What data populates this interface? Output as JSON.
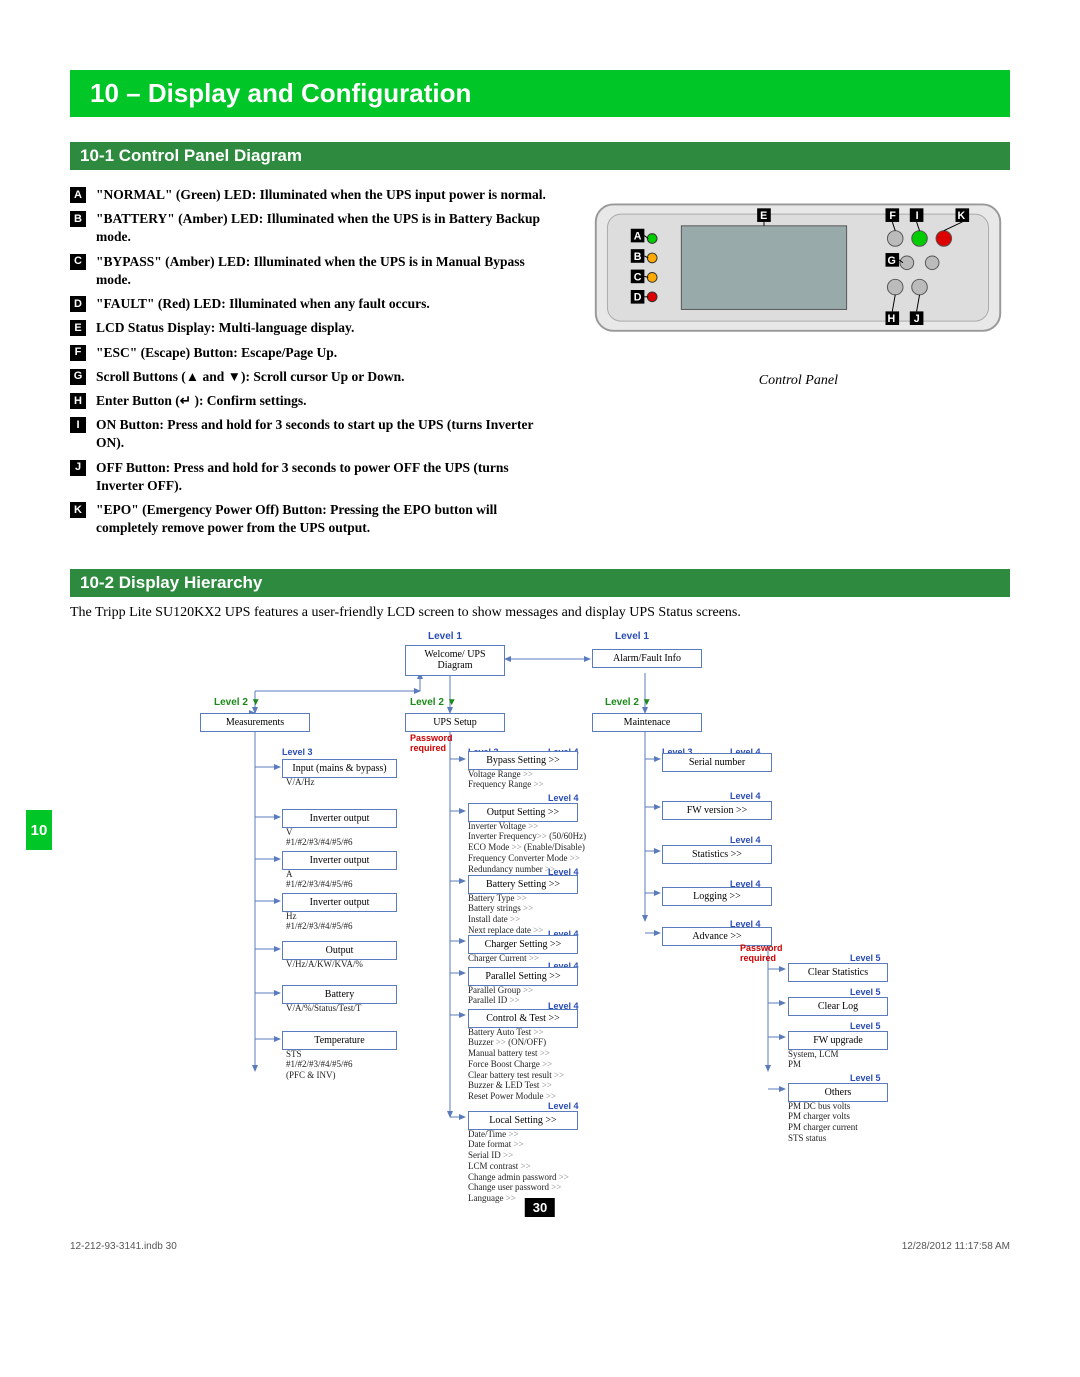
{
  "chapter": "10 – Display and Configuration",
  "section1": "10-1 Control Panel Diagram",
  "legend": {
    "A": "\"NORMAL\"  (Green) LED: Illuminated when the UPS input power is normal.",
    "B": "\"BATTERY\" (Amber) LED: Illuminated when the UPS is in Battery Backup mode.",
    "C": "\"BYPASS\" (Amber) LED: Illuminated when the UPS is in Manual Bypass mode.",
    "D": "\"FAULT\" (Red) LED: Illuminated when any fault occurs.",
    "E": "LCD Status Display: Multi-language display.",
    "F": "\"ESC\" (Escape) Button: Escape/Page Up.",
    "G": "Scroll Buttons (▲ and ▼): Scroll cursor Up or Down.",
    "H": "Enter Button (↵ ): Confirm settings.",
    "I": "ON Button: Press and hold for 3 seconds to start up the UPS (turns Inverter ON).",
    "J": "OFF Button: Press and hold for 3 seconds to power OFF the UPS (turns Inverter OFF).",
    "K": "\"EPO\" (Emergency Power Off) Button: Pressing the EPO button will completely remove power from the UPS output."
  },
  "panel_caption": "Control Panel",
  "section2": "10-2 Display Hierarchy",
  "intro": "The Tripp Lite SU120KX2 UPS features a user-friendly LCD screen to show messages and display UPS Status screens.",
  "side_tab": "10",
  "page_number": "30",
  "footer_left": "12-212-93-3141.indb   30",
  "footer_right": "12/28/2012   11:17:58 AM",
  "chart_data": {
    "type": "tree",
    "level1": [
      {
        "id": "welcome",
        "label": "Welcome/\nUPS Diagram"
      },
      {
        "id": "alarm",
        "label": "Alarm/Fault Info"
      }
    ],
    "level2": [
      {
        "parent": "welcome",
        "id": "measurements",
        "label": "Measurements",
        "color": "green"
      },
      {
        "parent": "welcome",
        "id": "upssetup",
        "label": "UPS Setup",
        "color": "green",
        "note": "Password required"
      },
      {
        "parent": "alarm",
        "id": "maintenance",
        "label": "Maintenace",
        "color": "green"
      }
    ],
    "measurements_level3": [
      {
        "label": "Input (mains & bypass)",
        "sub": "V/A/Hz"
      },
      {
        "label": "Inverter output",
        "sub": "V\n#1/#2/#3/#4/#5/#6"
      },
      {
        "label": "Inverter output",
        "sub": "A\n#1/#2/#3/#4/#5/#6"
      },
      {
        "label": "Inverter output",
        "sub": "Hz\n#1/#2/#3/#4/#5/#6"
      },
      {
        "label": "Output",
        "sub": "V/Hz/A/KW/KVA/%"
      },
      {
        "label": "Battery",
        "sub": "V/A/%/Status/Test/T"
      },
      {
        "label": "Temperature",
        "sub": "STS\n#1/#2/#3/#4/#5/#6\n(PFC & INV)"
      }
    ],
    "upssetup_level3_4": [
      {
        "l3": "Bypass Setting >>",
        "l4": [
          "Voltage Range >>",
          "Frequency Range >>"
        ]
      },
      {
        "l3": "Output Setting >>",
        "l4": [
          "Inverter Voltage >>",
          "Inverter Frequency>> (50/60Hz)",
          "ECO Mode >> (Enable/Disable)",
          "Frequency Converter Mode >>",
          "Redundancy number >>"
        ]
      },
      {
        "l3": "Battery Setting >>",
        "l4": [
          "Battery Type >>",
          "Battery strings >>",
          "Install date >>",
          "Next replace date >>"
        ]
      },
      {
        "l3": "Charger Setting >>",
        "l4": [
          "Charger Current >>"
        ]
      },
      {
        "l3": "Parallel Setting >>",
        "l4": [
          "Parallel Group >>",
          "Parallel ID >>"
        ]
      },
      {
        "l3": "Control & Test >>",
        "l4": [
          "Battery Auto Test >>",
          "Buzzer >> (ON/OFF)",
          "Manual battery test >>",
          "Force Boost Charge >>",
          "Clear battery test result >>",
          "Buzzer & LED Test >>",
          "Reset Power Module >>"
        ]
      },
      {
        "l3": "Local Setting >>",
        "l4": [
          "Date/Time >>",
          "Date format >>",
          "Serial ID >>",
          "LCM contrast >>",
          "Change admin password >>",
          "Change user password >>",
          "Language >>"
        ]
      }
    ],
    "maintenance_level3_4": [
      {
        "l4": "Serial number"
      },
      {
        "l4": "FW version >>"
      },
      {
        "l4": "Statistics  >>"
      },
      {
        "l4": "Logging >>"
      },
      {
        "l4": "Advance >>",
        "note": "Password required",
        "level5": [
          {
            "label": "Clear Statistics"
          },
          {
            "label": "Clear Log"
          },
          {
            "label": "FW upgrade",
            "sub": "System, LCM\nPM"
          },
          {
            "label": "Others",
            "sub": "PM DC bus volts\nPM charger volts\nPM charger current\nSTS status"
          }
        ]
      }
    ]
  }
}
